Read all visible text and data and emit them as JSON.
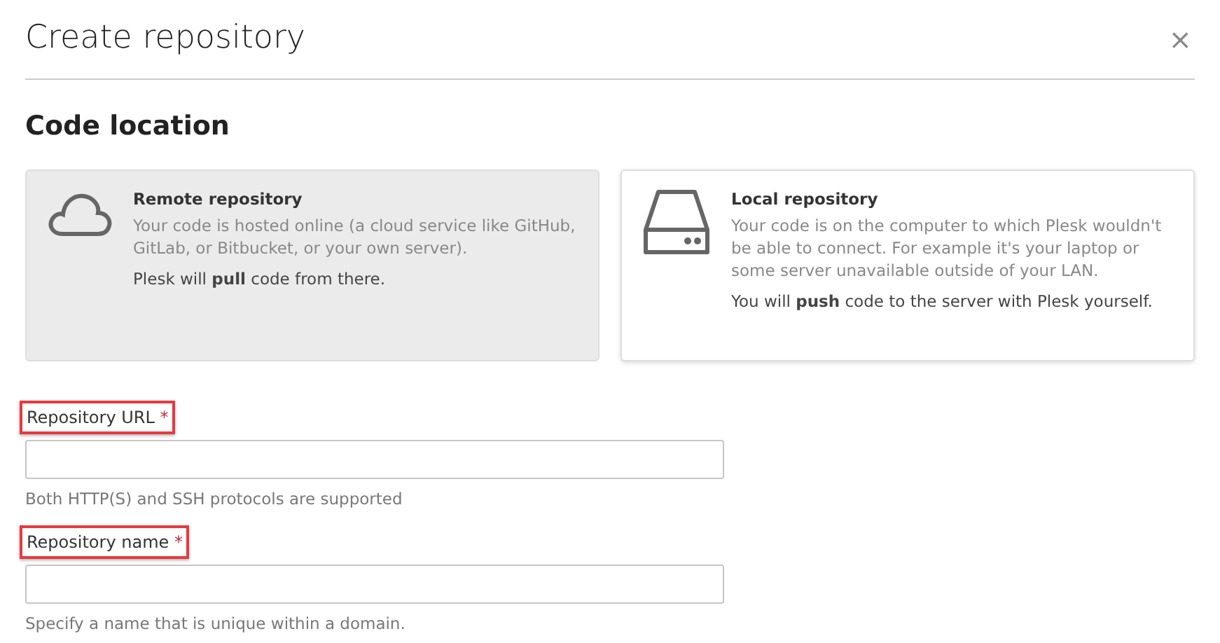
{
  "dialog": {
    "title": "Create repository",
    "close": "×"
  },
  "section": {
    "title": "Code location"
  },
  "options": [
    {
      "kind": "cloud",
      "title": "Remote repository",
      "description": "Your code is hosted online (a cloud service like GitHub, GitLab, or Bitbucket, or your own server).",
      "note": "Plesk will **pull** code from there.",
      "selected": true
    },
    {
      "kind": "drive",
      "title": "Local repository",
      "description": "Your code is on the computer to which Plesk wouldn't be able to connect. For example it's your laptop or some server unavailable outside of your LAN.",
      "note": "You will **push** code to the server with Plesk yourself.",
      "selected": false
    }
  ],
  "fields": [
    {
      "label": "Repository URL",
      "required_mark": "*",
      "highlighted": true,
      "help": "Both HTTP(S) and SSH protocols are supported"
    },
    {
      "label": "Repository name",
      "required_mark": "*",
      "highlighted": true,
      "help": "Specify a name that is unique within a domain."
    }
  ]
}
